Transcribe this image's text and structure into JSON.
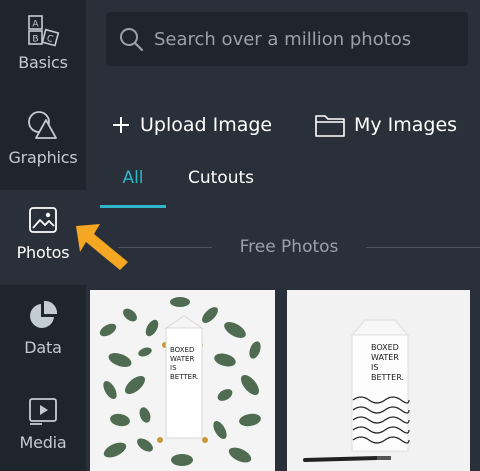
{
  "sidebar": {
    "items": [
      {
        "label": "Basics",
        "icon": "basics-abc-blocks-icon"
      },
      {
        "label": "Graphics",
        "icon": "shapes-icon"
      },
      {
        "label": "Photos",
        "icon": "image-icon",
        "active": true
      },
      {
        "label": "Data",
        "icon": "pie-chart-icon"
      },
      {
        "label": "Media",
        "icon": "video-icon"
      }
    ]
  },
  "search": {
    "placeholder": "Search over a million photos"
  },
  "actions": {
    "upload": "Upload Image",
    "my_images": "My Images"
  },
  "tabs": [
    {
      "label": "All",
      "active": true
    },
    {
      "label": "Cutouts"
    }
  ],
  "section": {
    "title": "Free Photos"
  },
  "photos": [
    {
      "text": "BOXED WATER IS BETTER."
    },
    {
      "text": "BOXED WATER IS BETTER."
    }
  ],
  "colors": {
    "sidebar_bg": "#1f252c",
    "main_bg": "#293039",
    "accent": "#2fb7c9",
    "arrow": "#f5a623"
  }
}
